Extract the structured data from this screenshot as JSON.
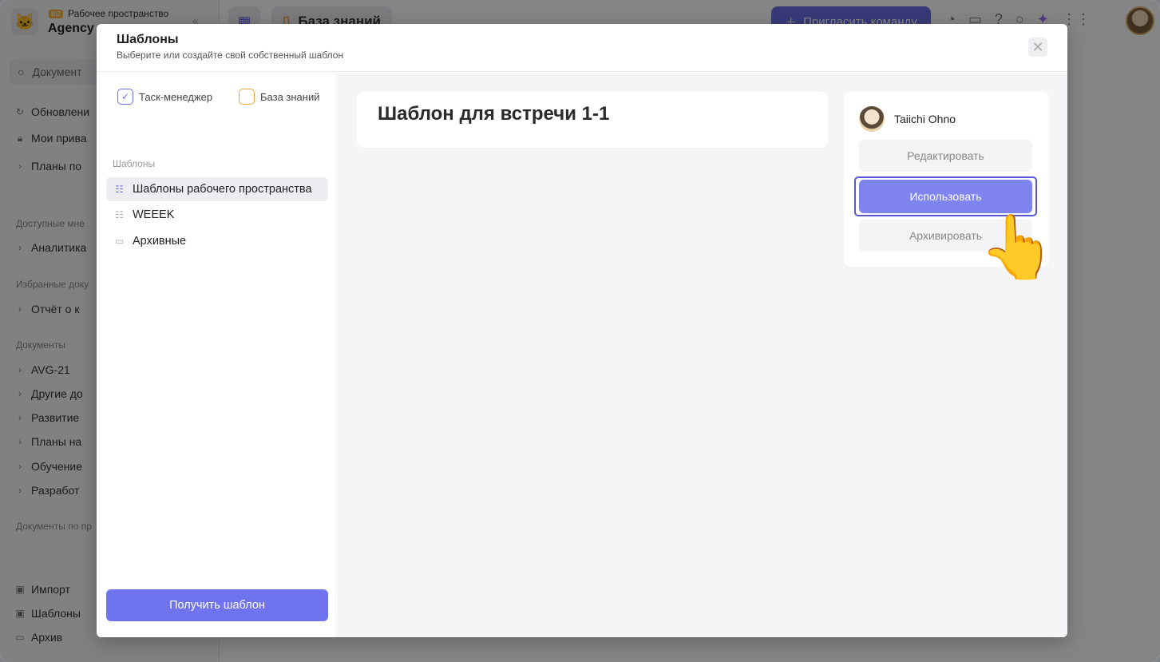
{
  "app": {
    "workspace_badge": "BIZ",
    "workspace_label": "Рабочее пространство",
    "workspace_name": "Agency",
    "search_placeholder": "Документ",
    "sidebar_items": [
      {
        "icon": "refresh-icon",
        "label": "Обновлени"
      },
      {
        "icon": "lock-icon",
        "label": "Мои прива"
      },
      {
        "icon": "plans-icon",
        "label": "Планы по"
      }
    ],
    "section_available": "Доступные мне",
    "available_items": [
      {
        "label": "Аналитика"
      }
    ],
    "section_favorites": "Избранные доку",
    "favorite_items": [
      {
        "label": "Отчёт о к"
      }
    ],
    "section_documents": "Документы",
    "document_items": [
      {
        "label": "AVG-21"
      },
      {
        "label": "Другие до"
      },
      {
        "label": "Развитие"
      },
      {
        "label": "Планы на"
      },
      {
        "label": "Обучение"
      },
      {
        "label": "Разработ"
      }
    ],
    "section_by_project": "Документы по пр",
    "bottom_items": [
      {
        "label": "Импорт"
      },
      {
        "label": "Шаблоны"
      },
      {
        "label": "Архив"
      }
    ],
    "breadcrumb": "База знаний",
    "invite_label": "Пригласить команду"
  },
  "modal": {
    "title": "Шаблоны",
    "subtitle": "Выберите или создайте свой собственный шаблон",
    "tabs": [
      {
        "label": "Таск-менеджер",
        "icon": "check-icon"
      },
      {
        "label": "База знаний",
        "icon": "document-icon"
      }
    ],
    "section_label": "Шаблоны",
    "categories": [
      {
        "label": "Шаблоны рабочего пространства",
        "active": true
      },
      {
        "label": "WEEEK",
        "active": false
      },
      {
        "label": "Архивные",
        "active": false
      }
    ],
    "get_template_label": "Получить шаблон",
    "template_title": "Шаблон для встречи 1-1",
    "author_name": "Taiichi Ohno",
    "edit_label": "Редактировать",
    "use_label": "Использовать",
    "archive_label": "Архивировать"
  },
  "colors": {
    "accent": "#6b6fe6",
    "use_button": "#7f84ef",
    "knowledge_base": "#f3a33a"
  }
}
